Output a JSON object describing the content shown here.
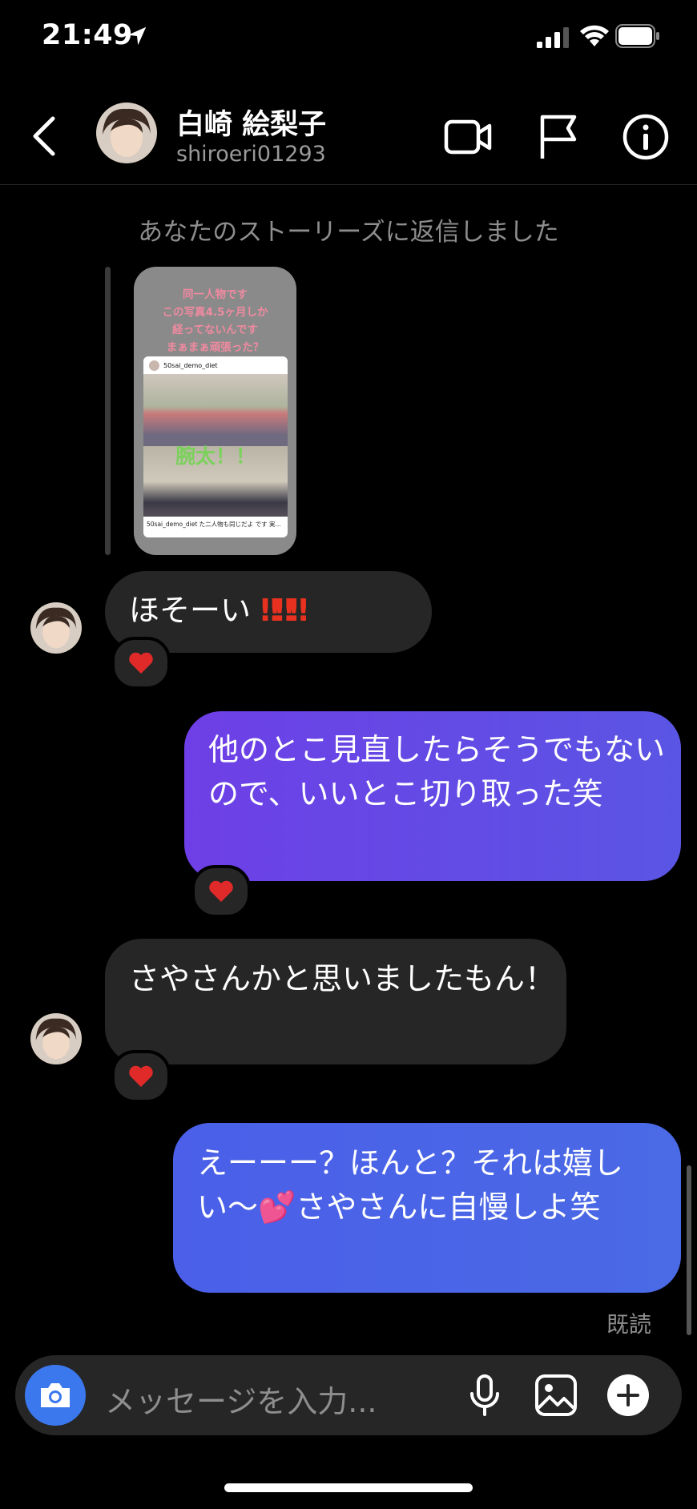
{
  "status_bar": {
    "time": "21:49"
  },
  "header": {
    "name": "白崎 絵梨子",
    "username": "shiroeri01293"
  },
  "story_reply": {
    "note": "あなたのストーリーズに返信しました",
    "caption_lines": [
      "同一人物です",
      "この写真4.5ヶ月しか",
      "経ってないんです",
      "まぁまぁ頑張った？"
    ],
    "post_user": "50sai_demo_diet",
    "overlay_text": "腕太！！",
    "post_caption": "50sai_demo_diet  た二人物も同じだよ です 実..."
  },
  "messages": [
    {
      "side": "incoming",
      "text": "ほそーい",
      "emoji": "‼‼‼",
      "reaction": "❤️"
    },
    {
      "side": "outgoing",
      "text": "他のとこ見直したらそうでもないので、いいとこ切り取った笑",
      "reaction": "❤️"
    },
    {
      "side": "incoming",
      "text": "さやさんかと思いましたもん！",
      "reaction": "❤️"
    },
    {
      "side": "outgoing",
      "text_before": "えーーー？ほんと？それは嬉しい〜",
      "emoji": "💕",
      "text_after": "さやさんに自慢しよ笑"
    }
  ],
  "seen_label": "既読",
  "composer": {
    "placeholder": "メッセージを入力..."
  },
  "colors": {
    "outgoing_top": "#6e3fe6",
    "outgoing_bottom": "#4a6ae6",
    "incoming": "#262626",
    "camera": "#3b78ee",
    "alert": "#e8311f"
  }
}
